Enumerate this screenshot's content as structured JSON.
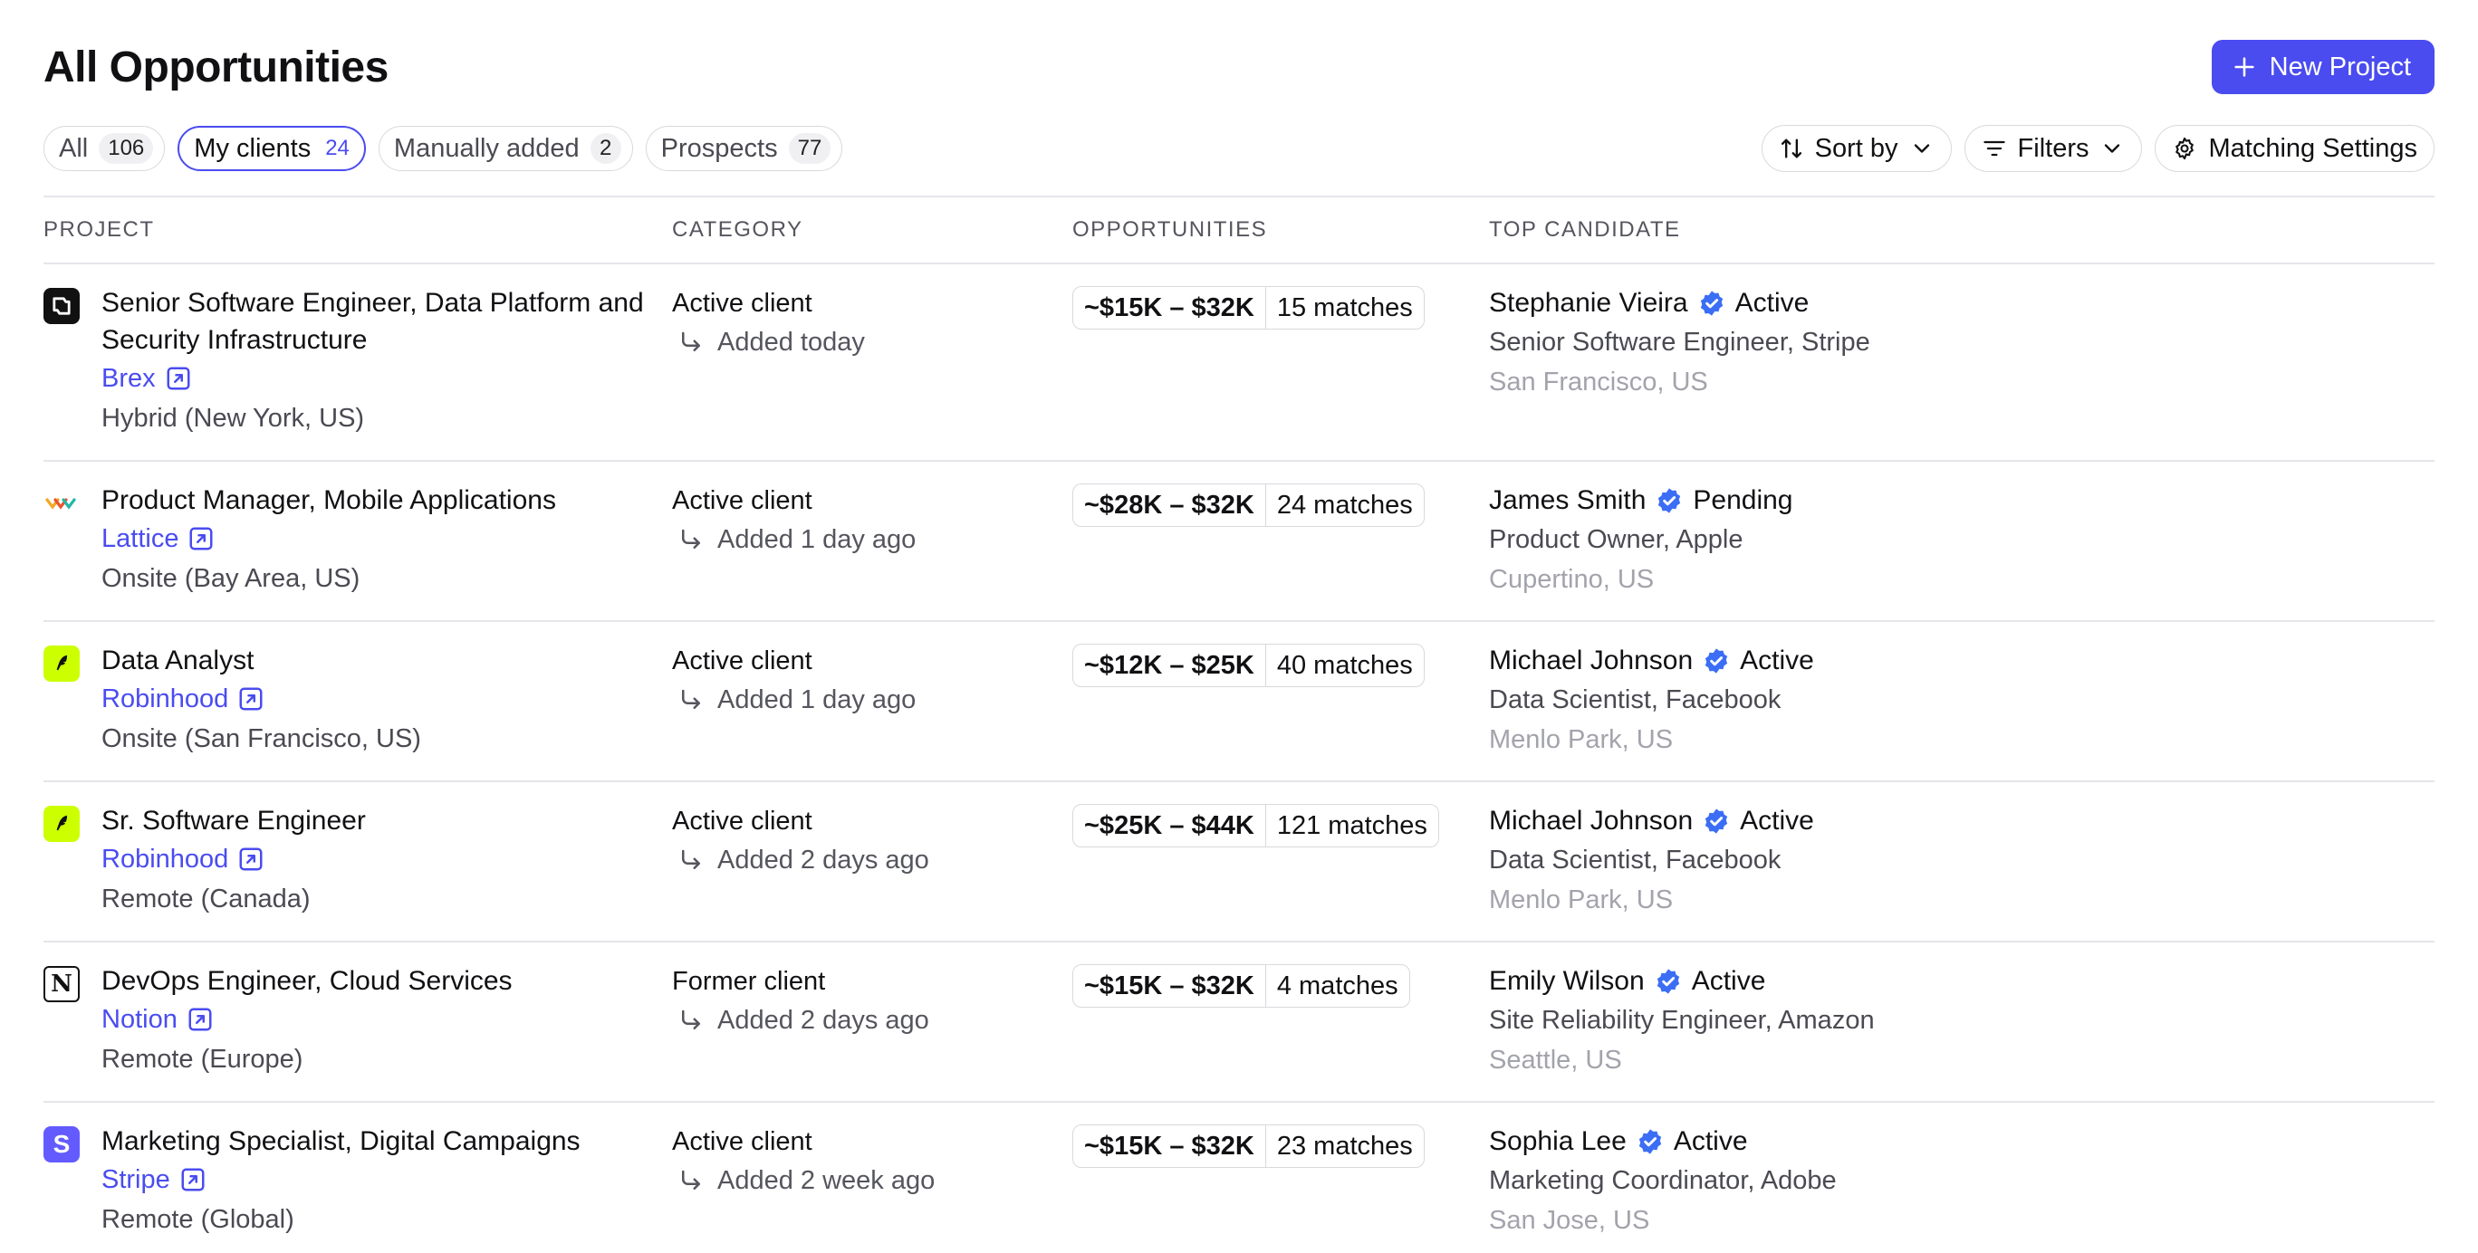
{
  "header": {
    "title": "All Opportunities",
    "new_project_label": "New Project"
  },
  "filters": [
    {
      "label": "All",
      "count": "106",
      "active": false
    },
    {
      "label": "My clients",
      "count": "24",
      "active": true
    },
    {
      "label": "Manually added",
      "count": "2",
      "active": false
    },
    {
      "label": "Prospects",
      "count": "77",
      "active": false
    }
  ],
  "tools": {
    "sort_label": "Sort by",
    "filters_label": "Filters",
    "matching_label": "Matching Settings"
  },
  "columns": {
    "project": "PROJECT",
    "category": "CATEGORY",
    "opportunities": "OPPORTUNITIES",
    "top_candidate": "TOP CANDIDATE"
  },
  "rows": [
    {
      "logo": "brex-icon",
      "title": "Senior Software Engineer, Data Platform and Security Infrastructure",
      "company": "Brex",
      "location": "Hybrid (New York, US)",
      "category": "Active client",
      "added": "Added today",
      "range": "~$15K – $32K",
      "matches": "15 matches",
      "candidate": "Stephanie Vieira",
      "candidate_status": "Active",
      "candidate_role": "Senior Software Engineer, Stripe",
      "candidate_location": "San Francisco, US"
    },
    {
      "logo": "lattice-icon",
      "title": "Product Manager, Mobile Applications",
      "company": "Lattice",
      "location": "Onsite (Bay Area, US)",
      "category": "Active client",
      "added": "Added 1 day ago",
      "range": "~$28K – $32K",
      "matches": "24 matches",
      "candidate": "James Smith",
      "candidate_status": "Pending",
      "candidate_role": "Product Owner, Apple",
      "candidate_location": "Cupertino, US"
    },
    {
      "logo": "robinhood-icon",
      "title": "Data Analyst",
      "company": "Robinhood",
      "location": "Onsite (San Francisco, US)",
      "category": "Active client",
      "added": "Added 1 day ago",
      "range": "~$12K – $25K",
      "matches": "40 matches",
      "candidate": "Michael Johnson",
      "candidate_status": "Active",
      "candidate_role": "Data Scientist, Facebook",
      "candidate_location": "Menlo Park, US"
    },
    {
      "logo": "robinhood-icon",
      "title": "Sr. Software Engineer",
      "company": "Robinhood",
      "location": "Remote (Canada)",
      "category": "Active client",
      "added": "Added 2 days ago",
      "range": "~$25K – $44K",
      "matches": "121 matches",
      "candidate": "Michael Johnson",
      "candidate_status": "Active",
      "candidate_role": "Data Scientist, Facebook",
      "candidate_location": "Menlo Park, US"
    },
    {
      "logo": "notion-icon",
      "title": "DevOps Engineer, Cloud Services",
      "company": "Notion",
      "location": "Remote (Europe)",
      "category": "Former client",
      "added": "Added 2 days ago",
      "range": "~$15K – $32K",
      "matches": "4 matches",
      "candidate": "Emily Wilson",
      "candidate_status": "Active",
      "candidate_role": "Site Reliability Engineer, Amazon",
      "candidate_location": "Seattle, US"
    },
    {
      "logo": "stripe-icon",
      "title": "Marketing Specialist, Digital Campaigns",
      "company": "Stripe",
      "location": "Remote (Global)",
      "category": "Active client",
      "added": "Added 2 week ago",
      "range": "~$15K – $32K",
      "matches": "23 matches",
      "candidate": "Sophia Lee",
      "candidate_status": "Active",
      "candidate_role": "Marketing Coordinator, Adobe",
      "candidate_location": "San Jose, US"
    }
  ],
  "colors": {
    "accent": "#4a4cf0",
    "verified": "#3b6ef5",
    "robinhood": "#ccff00",
    "stripe": "#635bff"
  }
}
